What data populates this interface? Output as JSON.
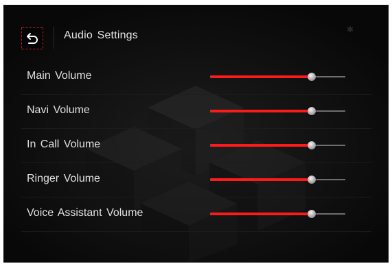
{
  "header": {
    "title": "Audio Settings",
    "back_icon": "back-arrow-icon"
  },
  "accent_color": "#ff1a1a",
  "volumes": [
    {
      "label": "Main Volume",
      "level": 0.75
    },
    {
      "label": "Navi Volume",
      "level": 0.75
    },
    {
      "label": "In Call Volume",
      "level": 0.75
    },
    {
      "label": "Ringer Volume",
      "level": 0.75
    },
    {
      "label": "Voice Assistant Volume",
      "level": 0.75
    }
  ]
}
